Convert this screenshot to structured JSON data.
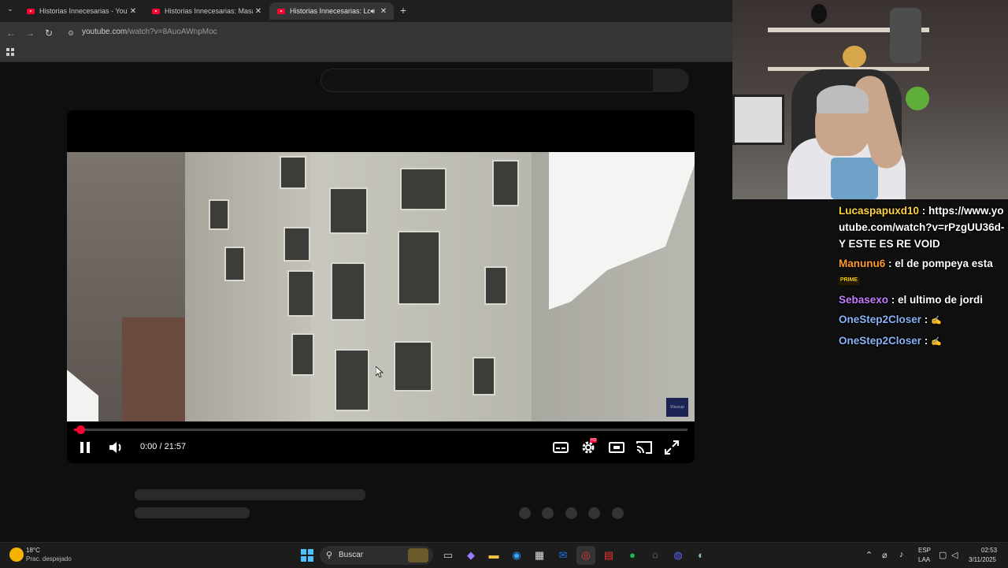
{
  "browser": {
    "tabs": [
      {
        "title": "Historias Innecesarias - YouTube",
        "active": false
      },
      {
        "title": "Historias Innecesarias: Masacre",
        "active": false
      },
      {
        "title": "Historias Innecesarias: Lou",
        "active": true
      }
    ],
    "new_tab_label": "+",
    "close_label": "✕",
    "url_domain": "youtube.com",
    "url_path": "/watch?v=8AuoAWnpMoc"
  },
  "player": {
    "time_current": "0:00",
    "time_separator": "/",
    "time_total": "21:57",
    "progress_fraction": 0.01,
    "watermark": "Wassup",
    "settings_badge": "HD"
  },
  "chat": {
    "messages": [
      {
        "user": "Lucaspapuxd10",
        "color": "#ffd23f",
        "text": "https://www.youtube.com/watch?v=rPzgUU36d-Y ESTE ES RE VOID"
      },
      {
        "user": "Manunu6",
        "color": "#ff9b2e",
        "text": "el de pompeya esta",
        "emote": "PRIME"
      },
      {
        "user": "Sebasexo",
        "color": "#c77dff",
        "text": "el ultimo de jordi"
      },
      {
        "user": "OneStep2Closer",
        "color": "#8ab4f8",
        "text": "✍"
      },
      {
        "user": "OneStep2Closer",
        "color": "#8ab4f8",
        "text": "✍"
      }
    ]
  },
  "taskbar": {
    "weather_temp": "18°C",
    "weather_desc": "Prac. despejado",
    "search_placeholder": "Buscar",
    "lang_top": "ESP",
    "lang_bottom": "LAA",
    "clock_time": "02:53",
    "clock_date": "3/11/2025"
  },
  "colors": {
    "accent_red": "#ff0033",
    "page_bg": "#0f0f0f"
  }
}
